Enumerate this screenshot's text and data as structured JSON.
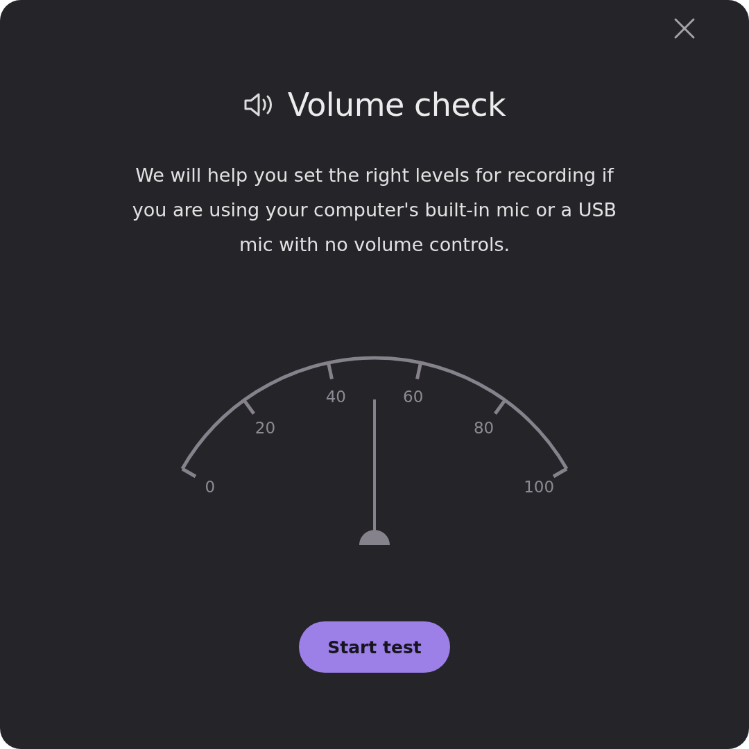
{
  "dialog": {
    "title": "Volume check",
    "description": "We will help you set the right levels for recording if you are using your computer's built-in mic or a USB mic with no volume controls.",
    "meter": {
      "ticks": [
        "0",
        "20",
        "40",
        "60",
        "80",
        "100"
      ]
    },
    "button": "Start test"
  }
}
